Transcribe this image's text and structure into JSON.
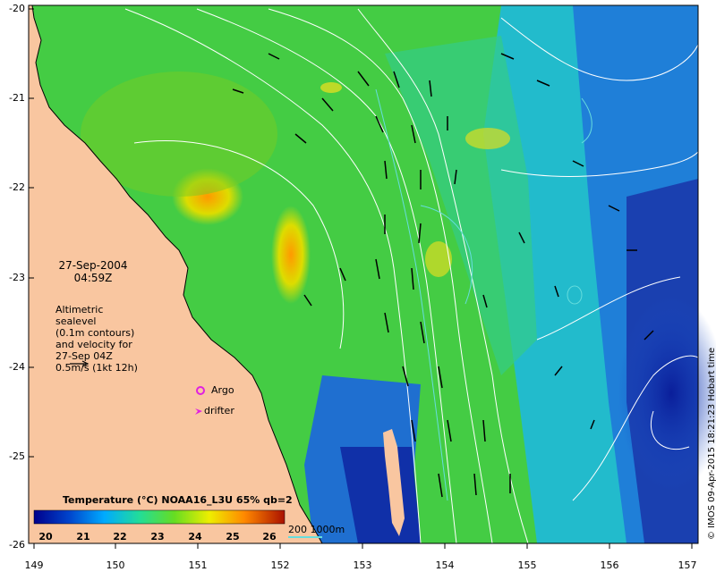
{
  "map": {
    "date": "27-Sep-2004",
    "time": "04:59Z",
    "legend_lines": [
      "Altimetric sealevel",
      "(0.1m contours)",
      "and velocity for",
      "27-Sep 04Z",
      "0.5m/s (1kt 12h)"
    ],
    "argo_label": "Argo",
    "drifter_label": "drifter",
    "colorbar_title": "Temperature (°C) NOAA16_L3U 65% qb=2",
    "colorbar_ticks": [
      "20",
      "21",
      "22",
      "23",
      "24",
      "25",
      "26"
    ],
    "depth_label": "200  1000m",
    "credit": "© IMOS 09-Apr-2015 18:21:23 Hobart time",
    "lat_ticks": [
      "-20",
      "-21",
      "-22",
      "-23",
      "-24",
      "-25",
      "-26"
    ],
    "lon_ticks": [
      "149",
      "150",
      "151",
      "152",
      "153",
      "154",
      "155",
      "156",
      "157"
    ],
    "colors": {
      "land": "#f9c6a0",
      "argo": "#e020e0",
      "drifter": "#e020e0",
      "contour": "#ffffff",
      "depth_contour": "#66dddd",
      "arrow": "#000000"
    }
  }
}
